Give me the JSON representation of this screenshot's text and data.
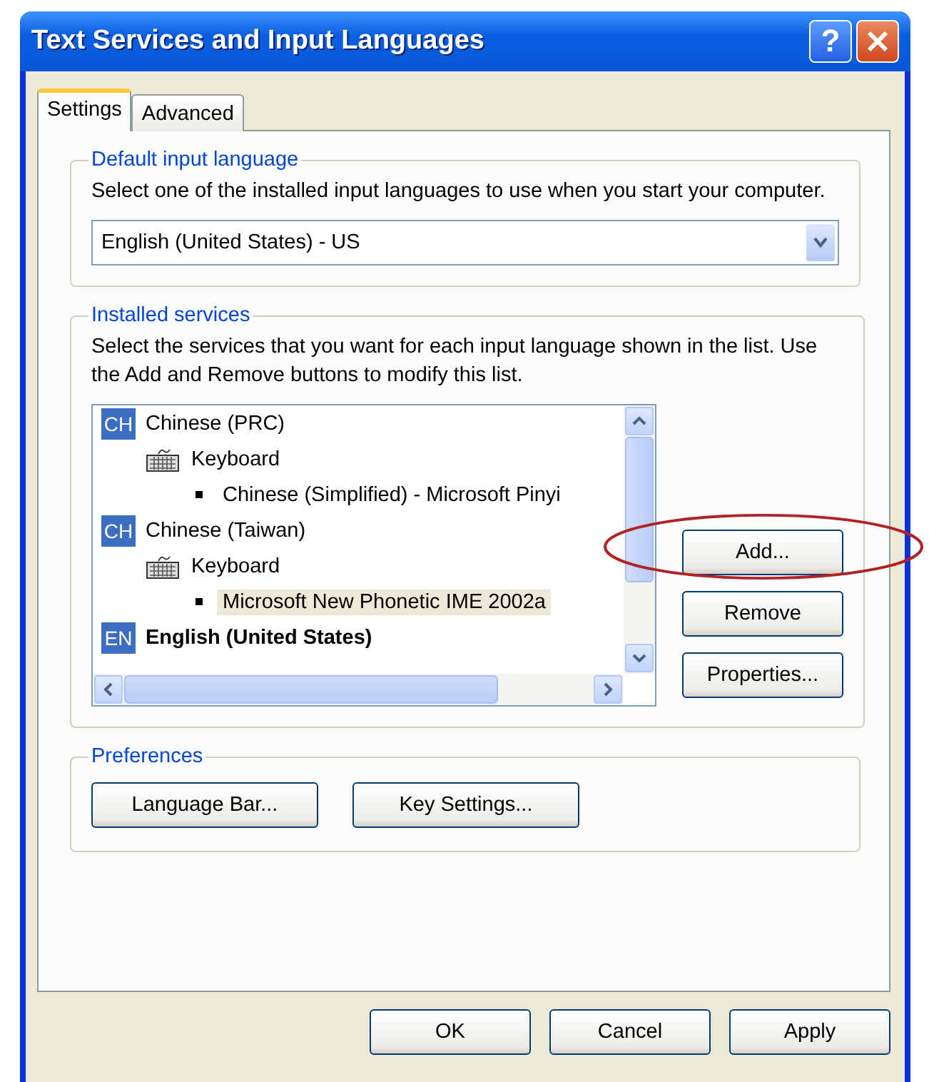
{
  "window": {
    "title": "Text Services and Input Languages"
  },
  "title_buttons": [
    {
      "kind": "help",
      "label": "?"
    },
    {
      "kind": "close"
    }
  ],
  "tabs": [
    {
      "label": "Settings",
      "selected": true
    },
    {
      "label": "Advanced",
      "selected": false
    }
  ],
  "default_input_language": {
    "title": "Default input language",
    "description": "Select one of the installed input languages to use when you start your computer.",
    "value": "English (United States) - US"
  },
  "installed_services": {
    "title": "Installed services",
    "description": "Select the services that you want for each input language shown in the list. Use the Add and Remove buttons to modify this list.",
    "languages": [
      {
        "badge": "CH",
        "name": "Chinese (PRC)",
        "default": false,
        "children": [
          {
            "name": "Keyboard",
            "children": [
              {
                "name": "Chinese (Simplified) - Microsoft Pinyi",
                "selected": false
              }
            ]
          }
        ]
      },
      {
        "badge": "CH",
        "name": "Chinese (Taiwan)",
        "default": false,
        "children": [
          {
            "name": "Keyboard",
            "children": [
              {
                "name": "Microsoft New Phonetic IME 2002a",
                "selected": true
              }
            ]
          }
        ]
      },
      {
        "badge": "EN",
        "name": "English (United States)",
        "default": true
      }
    ],
    "buttons": [
      {
        "label": "Add...",
        "circled": true
      },
      {
        "label": "Remove",
        "circled": false
      },
      {
        "label": "Properties...",
        "circled": false
      }
    ]
  },
  "preferences": {
    "title": "Preferences",
    "buttons": [
      "Language Bar...",
      "Key Settings..."
    ]
  },
  "dialog_buttons": [
    "OK",
    "Cancel",
    "Apply"
  ]
}
